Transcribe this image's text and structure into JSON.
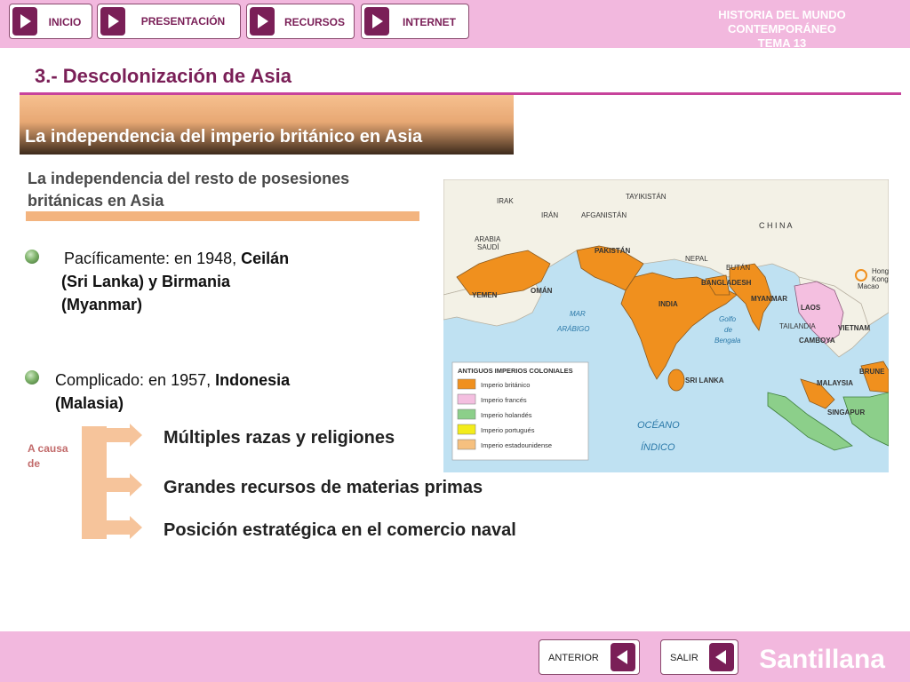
{
  "nav": [
    {
      "label": "INICIO"
    },
    {
      "label": "PRESENTACIÓN"
    },
    {
      "label": "RECURSOS"
    },
    {
      "label": "INTERNET"
    }
  ],
  "header": {
    "line1": "HISTORIA DEL MUNDO CONTEMPORÁNEO",
    "line2": "TEMA 13"
  },
  "section_title": "3.- Descolonización de Asia",
  "banner": "La independencia del imperio británico en Asia",
  "subheading": "La independencia del resto de posesiones británicas en Asia",
  "bullets": [
    {
      "prefix": "Pacíficamente: en 1948, ",
      "bold1": "Ceilán",
      "line2": "(Sri Lanka)  y Birmania",
      "line3": "(Myanmar)"
    },
    {
      "prefix": "Complicado: en 1957, ",
      "bold1": "Indonesia",
      "line2": "(Malasia)"
    }
  ],
  "a_causa": "A causa de",
  "causes": [
    "Múltiples razas y religiones",
    "Grandes recursos de materias primas",
    "Posición estratégica en el comercio naval"
  ],
  "map": {
    "labels": [
      "IRAK",
      "IRÁN",
      "AFGANISTÁN",
      "TAYIKISTÁN",
      "ARABIA",
      "SAUDÍ",
      "PAKISTÁN",
      "NEPAL",
      "BUTÁN",
      "C  H  I  N  A",
      "Hong",
      "Kong",
      "Macao",
      "YEMEN",
      "OMÁN",
      "INDIA",
      "BANGLADESH",
      "MYANMAR",
      "LAOS",
      "TAILANDIA",
      "CAMBOYA",
      "VIETNAM",
      "MAR",
      "ARÁBIGO",
      "Golfo",
      "de",
      "Bengala",
      "SRI LANKA",
      "BRUNE",
      "MALAYSIA",
      "SINGAPUR",
      "OCÉANO",
      "ÍNDICO"
    ],
    "legend_title": "ANTIGUOS IMPERIOS COLONIALES",
    "legend": [
      {
        "label": "Imperio británico",
        "color": "#f0901e"
      },
      {
        "label": "Imperio francés",
        "color": "#f4bfe0"
      },
      {
        "label": "Imperio holandés",
        "color": "#8ccf8a"
      },
      {
        "label": "Imperio portugués",
        "color": "#f3ec1a"
      },
      {
        "label": "Imperio estadounidense",
        "color": "#f6c07f"
      }
    ]
  },
  "footer": {
    "prev": "ANTERIOR",
    "exit": "SALIR",
    "brand": "Santillana"
  },
  "colors": {
    "accent": "#7a1f57",
    "pink_bar": "#f2b8de",
    "rule": "#c7439b",
    "banner": "#e8a874"
  }
}
